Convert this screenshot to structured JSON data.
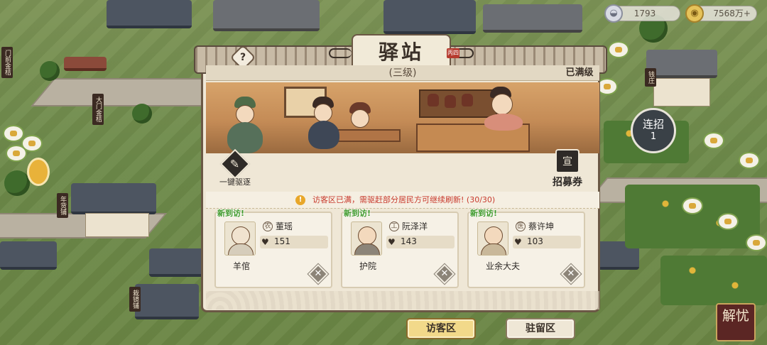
{
  "currency": {
    "silver": {
      "icon": "silver-ingot-icon",
      "value": "1793"
    },
    "gold": {
      "icon": "gold-coin-icon",
      "value": "7568万+"
    }
  },
  "map_signs": [
    "门前金桔",
    "大门金桔",
    "年货铺",
    "钱庄",
    "栽镜铺"
  ],
  "side": {
    "lianzhao_label": "连招",
    "lianzhao_count": "1",
    "jieyou_label": "解忧"
  },
  "dialog": {
    "title": "驿站",
    "seal_text": "丙四",
    "level": "(三级)",
    "max_level": "已满级",
    "help_icon": "?",
    "expel_label": "一键驱逐",
    "recruit_label": "招募券",
    "recruit_icon_text": "宣",
    "notice": "访客区已满，需驱赶部分居民方可继续刷新! (30/30)",
    "visitors": [
      {
        "badge": "新到访!",
        "tag": "农",
        "name": "董瑶",
        "stat": "151",
        "occupation": "羊倌"
      },
      {
        "badge": "新到访!",
        "tag": "工",
        "name": "阮泽洋",
        "stat": "143",
        "occupation": "护院"
      },
      {
        "badge": "新到访!",
        "tag": "医",
        "name": "蔡许坤",
        "stat": "103",
        "occupation": "业余大夫"
      }
    ],
    "buttons": {
      "visit": "访客区",
      "stay": "驻留区"
    }
  },
  "colors": {
    "accent": "#c83a2d",
    "new_badge": "#3f9a2c",
    "primary_btn": "#f2d98a",
    "frame": "#6b5845"
  }
}
